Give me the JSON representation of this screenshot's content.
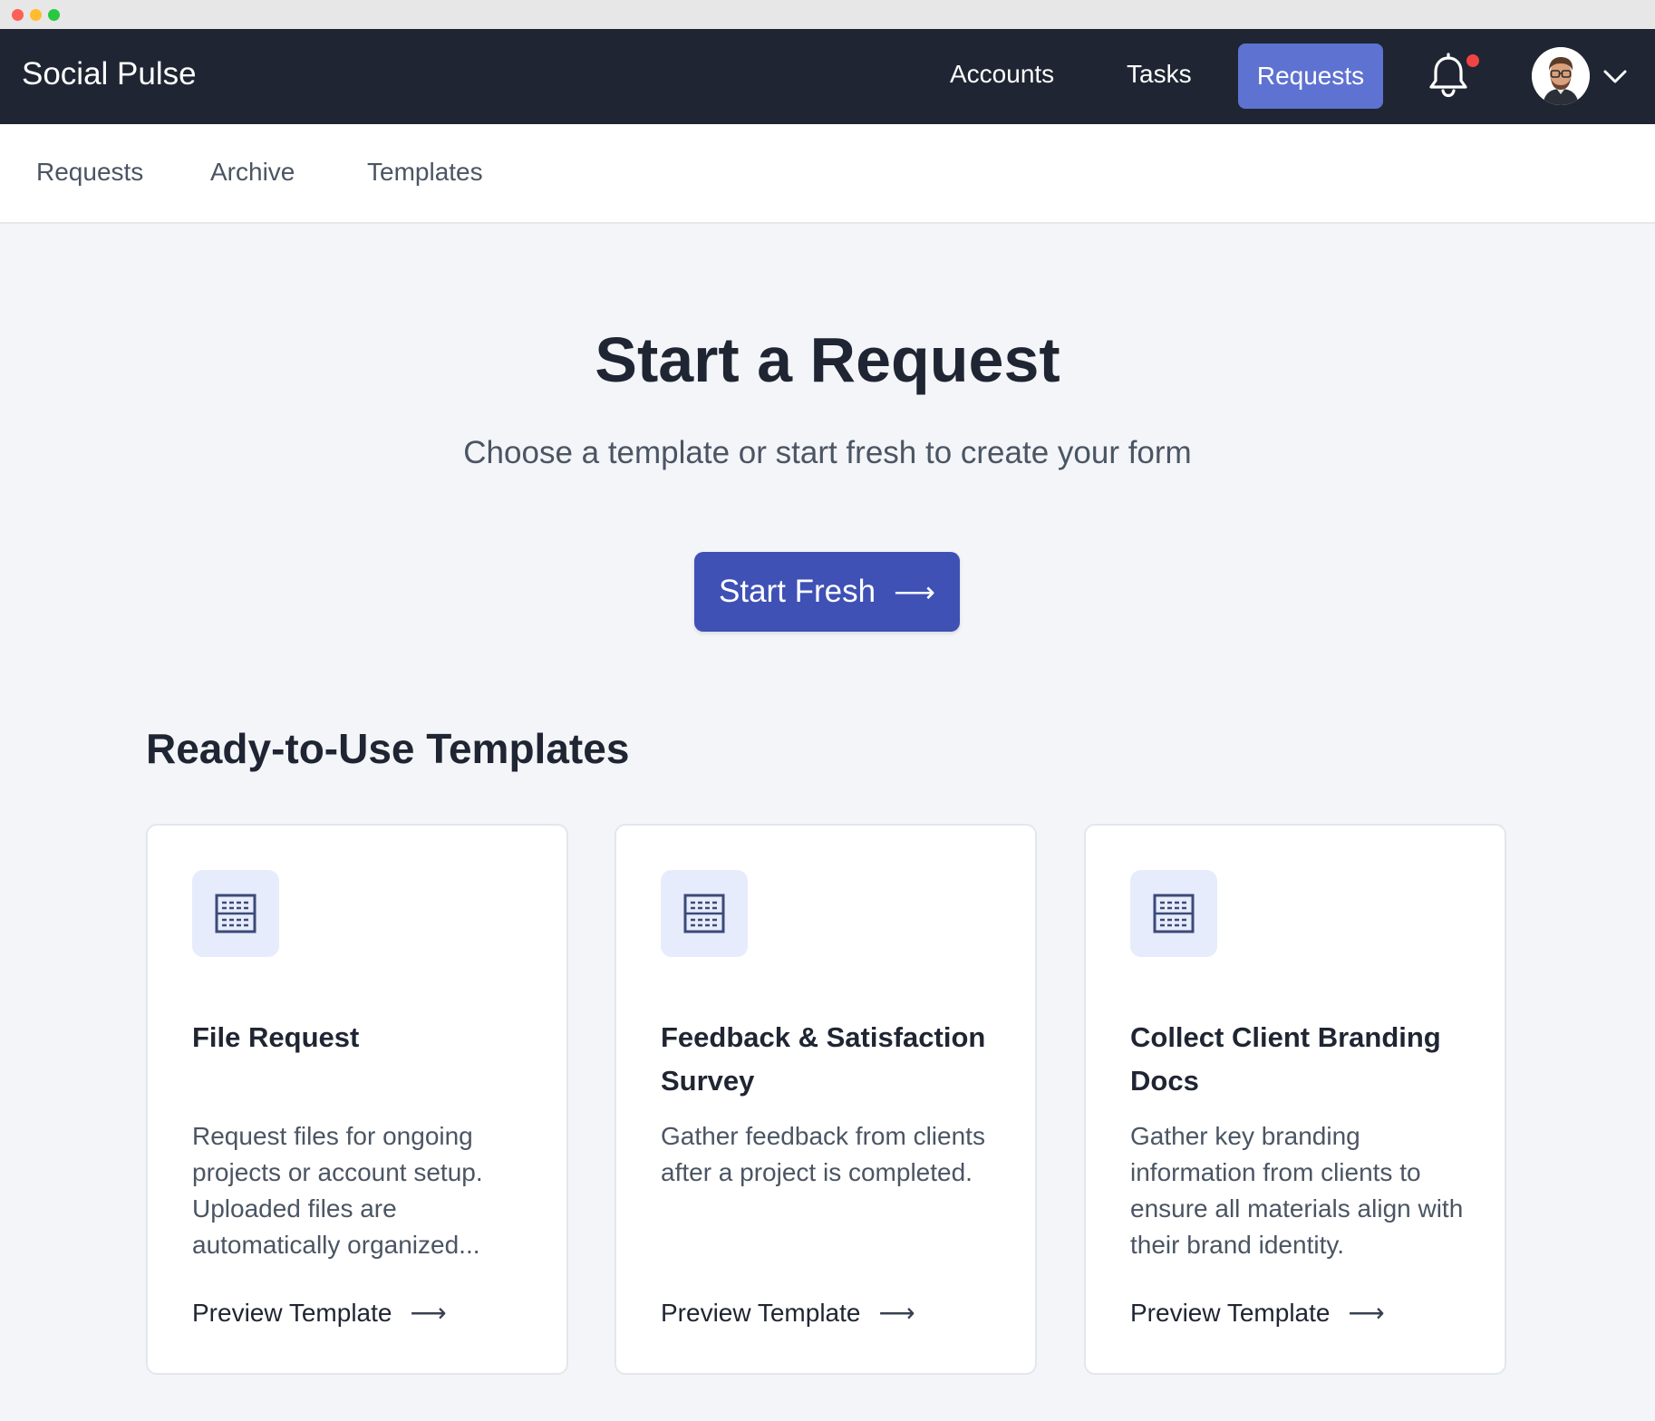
{
  "window": {
    "controls": [
      "close",
      "minimize",
      "maximize"
    ]
  },
  "topnav": {
    "brand": "Social Pulse",
    "links": [
      {
        "label": "Accounts"
      },
      {
        "label": "Tasks"
      },
      {
        "label": "Requests",
        "active": true
      }
    ],
    "bell_icon": "bell-icon",
    "has_notification_dot": true,
    "avatar": "user-avatar",
    "chevron_icon": "chevron-down-icon"
  },
  "subnav": {
    "tabs": [
      {
        "label": "Requests"
      },
      {
        "label": "Archive"
      },
      {
        "label": "Templates"
      }
    ]
  },
  "main": {
    "title": "Start a Request",
    "subtitle": "Choose a template or start fresh to create your form",
    "start_button": {
      "label": "Start Fresh",
      "icon": "arrow-right-icon"
    },
    "templates_heading": "Ready-to-Use Templates",
    "templates": [
      {
        "icon": "form-template-icon",
        "title": "File Request",
        "description": "Request files for ongoing projects or account setup. Uploaded files are automatically organized...",
        "link": "Preview Template"
      },
      {
        "icon": "form-template-icon",
        "title": "Feedback & Satisfaction Survey",
        "description": "Gather feedback from clients after a project is completed.",
        "link": "Preview Template"
      },
      {
        "icon": "form-template-icon",
        "title": "Collect Client Branding Docs",
        "description": "Gather key branding information from clients to ensure all materials align with their brand identity.",
        "link": "Preview Template"
      }
    ]
  },
  "colors": {
    "nav_bg": "#1f2532",
    "nav_active": "#5e72d1",
    "primary_button": "#3f51b5",
    "page_bg": "#f3f5f9",
    "icon_tile_bg": "#e6ecfb",
    "notification_dot": "#ef4444"
  }
}
